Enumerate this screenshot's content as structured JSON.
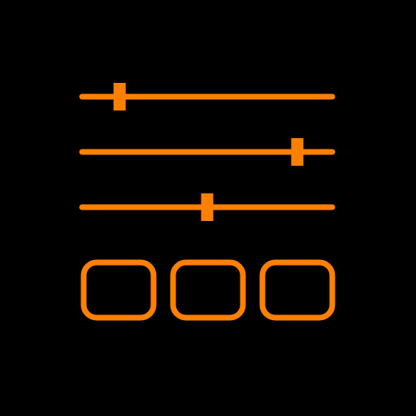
{
  "colors": {
    "background": "#000000",
    "accent": "#FF8000"
  },
  "icon": "equalizer-sliders-and-preset-buttons-icon",
  "sliders": [
    {
      "name": "slider-1",
      "value_fraction": 0.15
    },
    {
      "name": "slider-2",
      "value_fraction": 0.86
    },
    {
      "name": "slider-3",
      "value_fraction": 0.5
    }
  ],
  "buttons": [
    {
      "name": "preset-button-1"
    },
    {
      "name": "preset-button-2"
    },
    {
      "name": "preset-button-3"
    }
  ]
}
